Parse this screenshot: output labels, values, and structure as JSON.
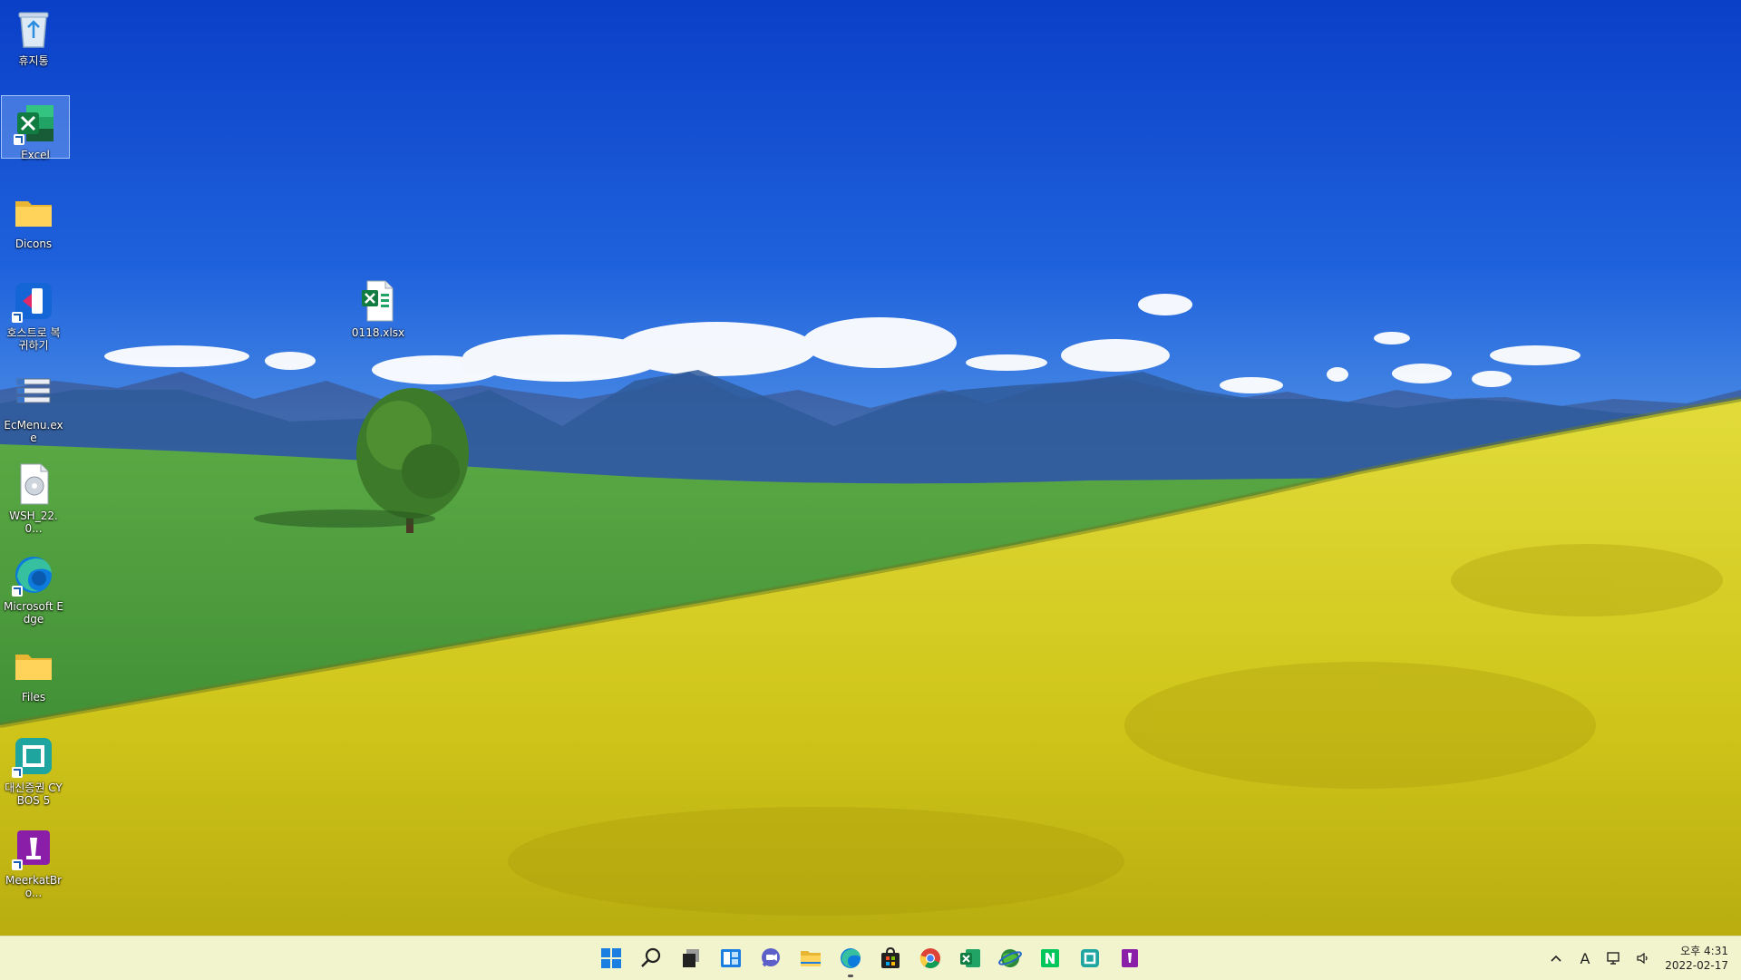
{
  "desktop": {
    "icons": [
      {
        "label": "휴지통",
        "icon": "recycle-bin-icon"
      },
      {
        "label": "Excel",
        "icon": "excel-icon",
        "selected": true
      },
      {
        "label": "Dicons",
        "icon": "folder-icon"
      },
      {
        "label": "호스트로 복귀하기",
        "icon": "host-return-icon"
      },
      {
        "label": "EcMenu.exe",
        "icon": "ecmenu-icon"
      },
      {
        "label": "WSH_22.0...",
        "icon": "document-disc-icon"
      },
      {
        "label": "Microsoft Edge",
        "icon": "edge-icon"
      },
      {
        "label": "Files",
        "icon": "folder-icon"
      },
      {
        "label": "대신증권 CYBOS 5",
        "icon": "cybos-icon"
      },
      {
        "label": "MeerkatBro...",
        "icon": "meerkat-icon"
      },
      {
        "label": "0118.xlsx",
        "icon": "xlsx-file-icon"
      }
    ]
  },
  "taskbar": {
    "apps": [
      {
        "name": "start",
        "icon": "windows-start-icon"
      },
      {
        "name": "search",
        "icon": "search-icon"
      },
      {
        "name": "task-view",
        "icon": "task-view-icon"
      },
      {
        "name": "widgets",
        "icon": "widgets-icon"
      },
      {
        "name": "chat",
        "icon": "teams-chat-icon"
      },
      {
        "name": "file-explorer",
        "icon": "file-explorer-icon"
      },
      {
        "name": "edge",
        "icon": "edge-icon",
        "active": true
      },
      {
        "name": "store",
        "icon": "microsoft-store-icon"
      },
      {
        "name": "chrome",
        "icon": "chrome-icon"
      },
      {
        "name": "excel",
        "icon": "excel-icon"
      },
      {
        "name": "browser-globe",
        "icon": "globe-browser-icon"
      },
      {
        "name": "naver",
        "icon": "naver-icon"
      },
      {
        "name": "cybos",
        "icon": "cybos-icon"
      },
      {
        "name": "meerkat",
        "icon": "meerkat-icon"
      }
    ],
    "tray": {
      "chevron": "^",
      "ime": "A",
      "clock_time": "오후 4:31",
      "clock_date": "2022-02-17"
    }
  },
  "colors": {
    "sky_top": "#0a3fc8",
    "sky_bottom": "#3c86e6",
    "meadow": "#4a9a3a",
    "rapeseed": "#d8d020",
    "taskbar": "#f0f3c8"
  }
}
